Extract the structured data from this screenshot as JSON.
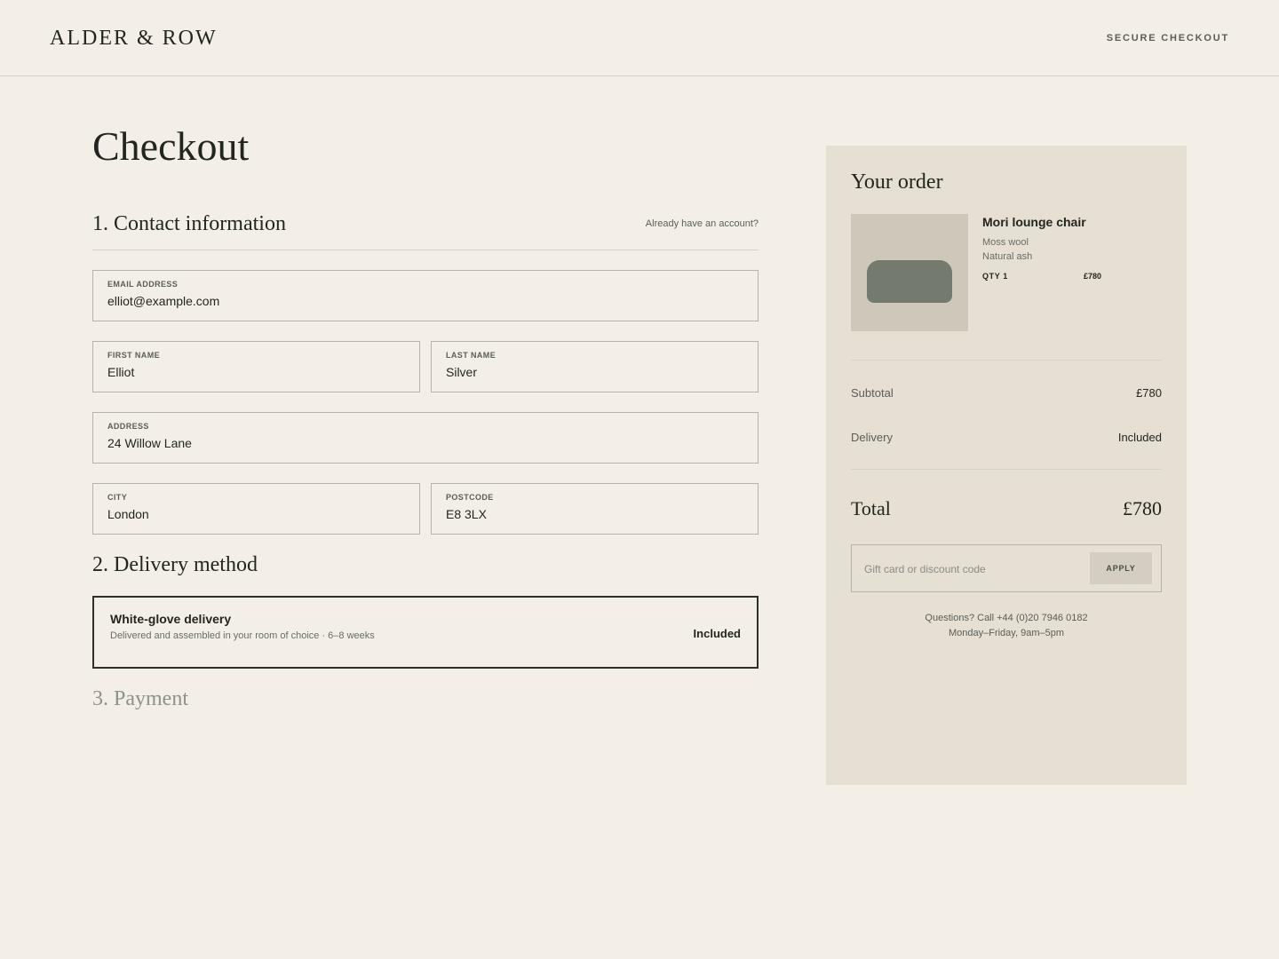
{
  "header": {
    "brand": "ALDER & ROW",
    "secure_label": "SECURE CHECKOUT"
  },
  "page_title": "Checkout",
  "contact": {
    "title": "1. Contact information",
    "account_link": "Already have an account?",
    "email": {
      "label": "EMAIL ADDRESS",
      "value": "elliot@example.com"
    },
    "first_name": {
      "label": "FIRST NAME",
      "value": "Elliot"
    },
    "last_name": {
      "label": "LAST NAME",
      "value": "Silver"
    },
    "address": {
      "label": "ADDRESS",
      "value": "24 Willow Lane"
    },
    "city": {
      "label": "CITY",
      "value": "London"
    },
    "postcode": {
      "label": "POSTCODE",
      "value": "E8 3LX"
    }
  },
  "delivery": {
    "title": "2. Delivery method",
    "option_name": "White-glove delivery",
    "option_desc": "Delivered and assembled in your room of choice · 6–8 weeks",
    "option_price": "Included"
  },
  "payment": {
    "title": "3. Payment"
  },
  "order": {
    "title": "Your order",
    "product": {
      "name": "Mori lounge chair",
      "option1": "Moss wool",
      "option2": "Natural ash",
      "qty_label": "QTY  1",
      "price": "£780"
    },
    "subtotal_label": "Subtotal",
    "subtotal_value": "£780",
    "delivery_label": "Delivery",
    "delivery_value": "Included",
    "total_label": "Total",
    "total_value": "£780",
    "discount_placeholder": "Gift card or discount code",
    "apply_label": "APPLY",
    "help_line1": "Questions? Call +44 (0)20 7946 0182",
    "help_line2": "Monday–Friday, 9am–5pm"
  }
}
